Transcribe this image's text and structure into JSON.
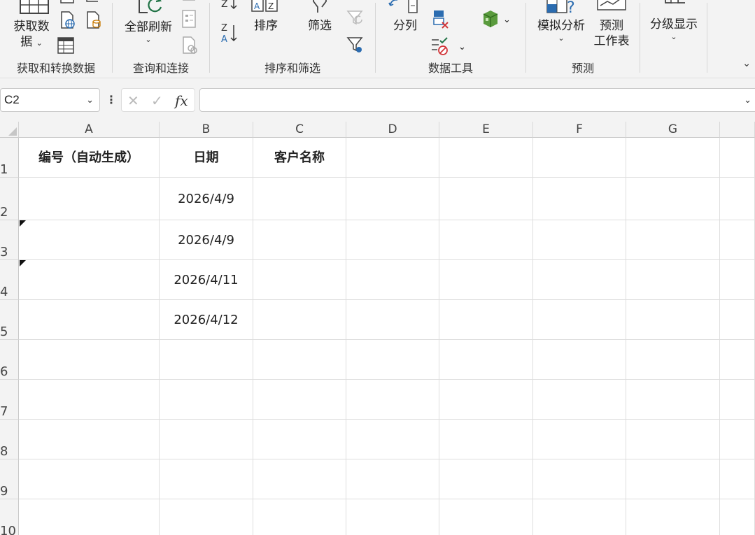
{
  "ribbon": {
    "groups": {
      "get_transform": {
        "label": "获取和转换数据",
        "get_data_line1": "获取数",
        "get_data_line2": "据"
      },
      "queries": {
        "label": "查询和连接",
        "refresh_all": "全部刷新"
      },
      "sort_filter": {
        "label": "排序和筛选",
        "sort": "排序",
        "filter": "筛选"
      },
      "data_tools": {
        "label": "数据工具",
        "text_to_columns": "分列"
      },
      "forecast": {
        "label": "预测",
        "what_if": "模拟分析",
        "forecast_sheet_line1": "预测",
        "forecast_sheet_line2": "工作表"
      },
      "outline": {
        "label": "分级显示",
        "outline_btn": "分级显示"
      }
    }
  },
  "formula_bar": {
    "name_box": "C2",
    "fx_label": "fx",
    "formula_value": ""
  },
  "sheet": {
    "columns": [
      "A",
      "B",
      "C",
      "D",
      "E",
      "F",
      "G"
    ],
    "rows": [
      "1",
      "2",
      "3",
      "4",
      "5",
      "6",
      "7",
      "8",
      "9",
      "10"
    ],
    "header_cells": {
      "A1": "编号（自动生成）",
      "B1": "日期",
      "C1": "客户名称"
    },
    "date_cells": [
      "2026/4/9",
      "2026/4/9",
      "2026/4/11",
      "2026/4/12"
    ]
  },
  "colors": {
    "ribbon_bg": "#f3f3f3",
    "excel_green": "#217346",
    "accent_blue": "#2b6cb0",
    "error_red": "#d13438"
  }
}
